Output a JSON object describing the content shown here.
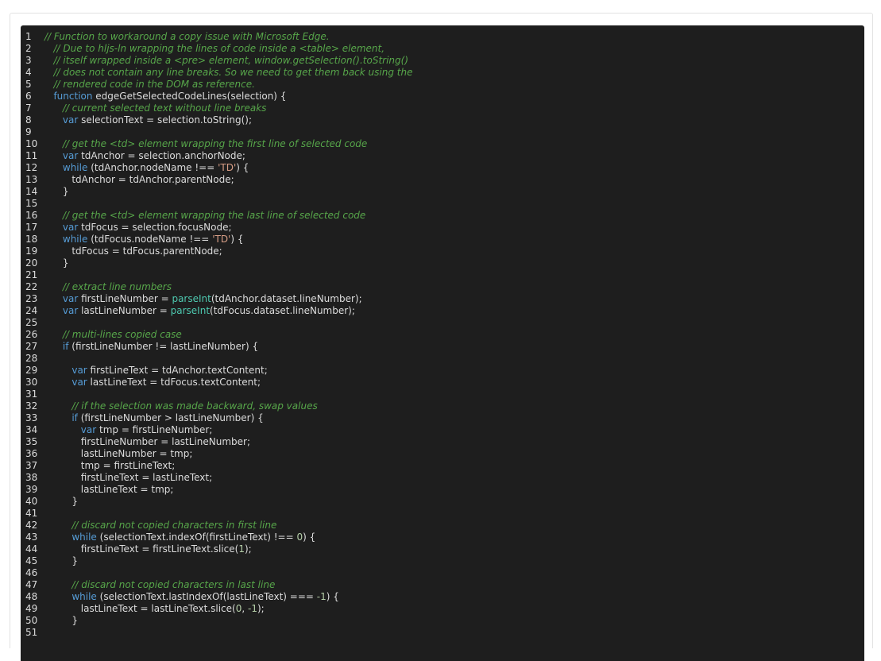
{
  "theme": {
    "background": "#1e1e1e",
    "text": "#dcdcdc",
    "comment": "#57a64a",
    "keyword": "#569cd6",
    "string": "#d69d85",
    "builtin": "#4ec9b0",
    "number": "#b5cea8"
  },
  "code": {
    "language": "javascript",
    "lines": [
      {
        "n": "1",
        "tokens": [
          [
            "comment",
            "// Function to workaround a copy issue with Microsoft Edge."
          ]
        ]
      },
      {
        "n": "2",
        "tokens": [
          [
            "plain",
            "   "
          ],
          [
            "comment",
            "// Due to hljs-ln wrapping the lines of code inside a <table> element,"
          ]
        ]
      },
      {
        "n": "3",
        "tokens": [
          [
            "plain",
            "   "
          ],
          [
            "comment",
            "// itself wrapped inside a <pre> element, window.getSelection().toString()"
          ]
        ]
      },
      {
        "n": "4",
        "tokens": [
          [
            "plain",
            "   "
          ],
          [
            "comment",
            "// does not contain any line breaks. So we need to get them back using the"
          ]
        ]
      },
      {
        "n": "5",
        "tokens": [
          [
            "plain",
            "   "
          ],
          [
            "comment",
            "// rendered code in the DOM as reference."
          ]
        ]
      },
      {
        "n": "6",
        "tokens": [
          [
            "plain",
            "   "
          ],
          [
            "keyword",
            "function"
          ],
          [
            "plain",
            " edgeGetSelectedCodeLines(selection) {"
          ]
        ]
      },
      {
        "n": "7",
        "tokens": [
          [
            "plain",
            "      "
          ],
          [
            "comment",
            "// current selected text without line breaks"
          ]
        ]
      },
      {
        "n": "8",
        "tokens": [
          [
            "plain",
            "      "
          ],
          [
            "keyword",
            "var"
          ],
          [
            "plain",
            " selectionText = selection.toString();"
          ]
        ]
      },
      {
        "n": "9",
        "tokens": []
      },
      {
        "n": "10",
        "tokens": [
          [
            "plain",
            "      "
          ],
          [
            "comment",
            "// get the <td> element wrapping the first line of selected code"
          ]
        ]
      },
      {
        "n": "11",
        "tokens": [
          [
            "plain",
            "      "
          ],
          [
            "keyword",
            "var"
          ],
          [
            "plain",
            " tdAnchor = selection.anchorNode;"
          ]
        ]
      },
      {
        "n": "12",
        "tokens": [
          [
            "plain",
            "      "
          ],
          [
            "keyword",
            "while"
          ],
          [
            "plain",
            " (tdAnchor.nodeName !== "
          ],
          [
            "string",
            "'TD'"
          ],
          [
            "plain",
            ") {"
          ]
        ]
      },
      {
        "n": "13",
        "tokens": [
          [
            "plain",
            "         tdAnchor = tdAnchor.parentNode;"
          ]
        ]
      },
      {
        "n": "14",
        "tokens": [
          [
            "plain",
            "      }"
          ]
        ]
      },
      {
        "n": "15",
        "tokens": []
      },
      {
        "n": "16",
        "tokens": [
          [
            "plain",
            "      "
          ],
          [
            "comment",
            "// get the <td> element wrapping the last line of selected code"
          ]
        ]
      },
      {
        "n": "17",
        "tokens": [
          [
            "plain",
            "      "
          ],
          [
            "keyword",
            "var"
          ],
          [
            "plain",
            " tdFocus = selection.focusNode;"
          ]
        ]
      },
      {
        "n": "18",
        "tokens": [
          [
            "plain",
            "      "
          ],
          [
            "keyword",
            "while"
          ],
          [
            "plain",
            " (tdFocus.nodeName !== "
          ],
          [
            "string",
            "'TD'"
          ],
          [
            "plain",
            ") {"
          ]
        ]
      },
      {
        "n": "19",
        "tokens": [
          [
            "plain",
            "         tdFocus = tdFocus.parentNode;"
          ]
        ]
      },
      {
        "n": "20",
        "tokens": [
          [
            "plain",
            "      }"
          ]
        ]
      },
      {
        "n": "21",
        "tokens": []
      },
      {
        "n": "22",
        "tokens": [
          [
            "plain",
            "      "
          ],
          [
            "comment",
            "// extract line numbers"
          ]
        ]
      },
      {
        "n": "23",
        "tokens": [
          [
            "plain",
            "      "
          ],
          [
            "keyword",
            "var"
          ],
          [
            "plain",
            " firstLineNumber = "
          ],
          [
            "builtin",
            "parseInt"
          ],
          [
            "plain",
            "(tdAnchor.dataset.lineNumber);"
          ]
        ]
      },
      {
        "n": "24",
        "tokens": [
          [
            "plain",
            "      "
          ],
          [
            "keyword",
            "var"
          ],
          [
            "plain",
            " lastLineNumber = "
          ],
          [
            "builtin",
            "parseInt"
          ],
          [
            "plain",
            "(tdFocus.dataset.lineNumber);"
          ]
        ]
      },
      {
        "n": "25",
        "tokens": []
      },
      {
        "n": "26",
        "tokens": [
          [
            "plain",
            "      "
          ],
          [
            "comment",
            "// multi-lines copied case"
          ]
        ]
      },
      {
        "n": "27",
        "tokens": [
          [
            "plain",
            "      "
          ],
          [
            "keyword",
            "if"
          ],
          [
            "plain",
            " (firstLineNumber != lastLineNumber) {"
          ]
        ]
      },
      {
        "n": "28",
        "tokens": []
      },
      {
        "n": "29",
        "tokens": [
          [
            "plain",
            "         "
          ],
          [
            "keyword",
            "var"
          ],
          [
            "plain",
            " firstLineText = tdAnchor.textContent;"
          ]
        ]
      },
      {
        "n": "30",
        "tokens": [
          [
            "plain",
            "         "
          ],
          [
            "keyword",
            "var"
          ],
          [
            "plain",
            " lastLineText = tdFocus.textContent;"
          ]
        ]
      },
      {
        "n": "31",
        "tokens": []
      },
      {
        "n": "32",
        "tokens": [
          [
            "plain",
            "         "
          ],
          [
            "comment",
            "// if the selection was made backward, swap values"
          ]
        ]
      },
      {
        "n": "33",
        "tokens": [
          [
            "plain",
            "         "
          ],
          [
            "keyword",
            "if"
          ],
          [
            "plain",
            " (firstLineNumber > lastLineNumber) {"
          ]
        ]
      },
      {
        "n": "34",
        "tokens": [
          [
            "plain",
            "            "
          ],
          [
            "keyword",
            "var"
          ],
          [
            "plain",
            " tmp = firstLineNumber;"
          ]
        ]
      },
      {
        "n": "35",
        "tokens": [
          [
            "plain",
            "            firstLineNumber = lastLineNumber;"
          ]
        ]
      },
      {
        "n": "36",
        "tokens": [
          [
            "plain",
            "            lastLineNumber = tmp;"
          ]
        ]
      },
      {
        "n": "37",
        "tokens": [
          [
            "plain",
            "            tmp = firstLineText;"
          ]
        ]
      },
      {
        "n": "38",
        "tokens": [
          [
            "plain",
            "            firstLineText = lastLineText;"
          ]
        ]
      },
      {
        "n": "39",
        "tokens": [
          [
            "plain",
            "            lastLineText = tmp;"
          ]
        ]
      },
      {
        "n": "40",
        "tokens": [
          [
            "plain",
            "         }"
          ]
        ]
      },
      {
        "n": "41",
        "tokens": []
      },
      {
        "n": "42",
        "tokens": [
          [
            "plain",
            "         "
          ],
          [
            "comment",
            "// discard not copied characters in first line"
          ]
        ]
      },
      {
        "n": "43",
        "tokens": [
          [
            "plain",
            "         "
          ],
          [
            "keyword",
            "while"
          ],
          [
            "plain",
            " (selectionText.indexOf(firstLineText) !== "
          ],
          [
            "number",
            "0"
          ],
          [
            "plain",
            ") {"
          ]
        ]
      },
      {
        "n": "44",
        "tokens": [
          [
            "plain",
            "            firstLineText = firstLineText.slice("
          ],
          [
            "number",
            "1"
          ],
          [
            "plain",
            ");"
          ]
        ]
      },
      {
        "n": "45",
        "tokens": [
          [
            "plain",
            "         }"
          ]
        ]
      },
      {
        "n": "46",
        "tokens": []
      },
      {
        "n": "47",
        "tokens": [
          [
            "plain",
            "         "
          ],
          [
            "comment",
            "// discard not copied characters in last line"
          ]
        ]
      },
      {
        "n": "48",
        "tokens": [
          [
            "plain",
            "         "
          ],
          [
            "keyword",
            "while"
          ],
          [
            "plain",
            " (selectionText.lastIndexOf(lastLineText) === "
          ],
          [
            "number",
            "-1"
          ],
          [
            "plain",
            ") {"
          ]
        ]
      },
      {
        "n": "49",
        "tokens": [
          [
            "plain",
            "            lastLineText = lastLineText.slice("
          ],
          [
            "number",
            "0"
          ],
          [
            "plain",
            ", "
          ],
          [
            "number",
            "-1"
          ],
          [
            "plain",
            ");"
          ]
        ]
      },
      {
        "n": "50",
        "tokens": [
          [
            "plain",
            "         }"
          ]
        ]
      },
      {
        "n": "51",
        "tokens": []
      }
    ]
  }
}
